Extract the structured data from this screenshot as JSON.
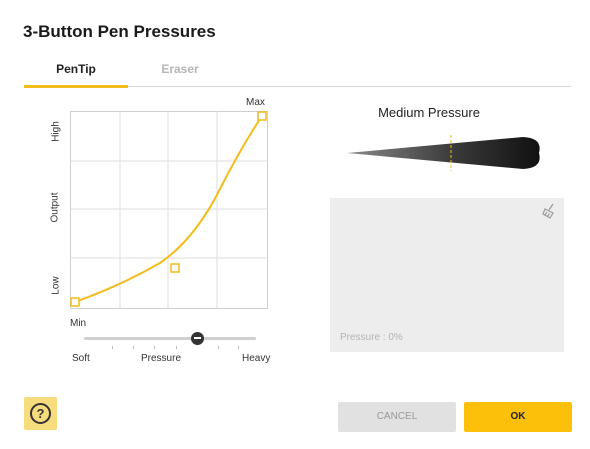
{
  "dialog": {
    "title": "3-Button Pen Pressures"
  },
  "tabs": [
    {
      "label": "PenTip",
      "active": true
    },
    {
      "label": "Eraser",
      "active": false
    }
  ],
  "graph": {
    "y_labels": {
      "high": "High",
      "output": "Output",
      "low": "Low"
    },
    "max_label": "Max",
    "min_label": "Min",
    "curve_color": "#f2bc1a"
  },
  "pressure_slider": {
    "left_label": "Soft",
    "center_label": "Pressure",
    "right_label": "Heavy",
    "value": 0.66
  },
  "preview": {
    "title": "Medium Pressure",
    "test_area_text": "Pressure : 0%",
    "clear_icon": "broom-icon"
  },
  "footer": {
    "help_label": "?",
    "cancel_label": "CANCEL",
    "ok_label": "OK"
  },
  "colors": {
    "accent": "#fcc00a",
    "help_bg": "#f6dc7c",
    "cancel_bg": "#e1e1e1"
  }
}
